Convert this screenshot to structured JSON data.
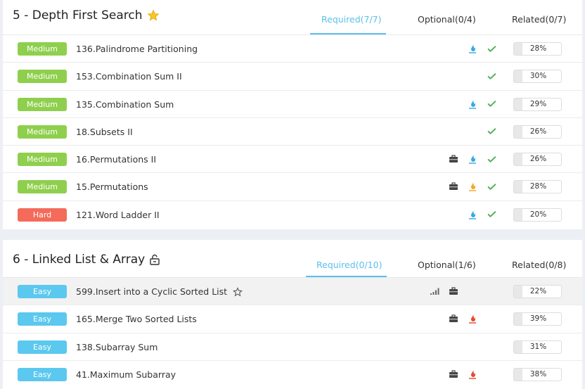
{
  "sections": [
    {
      "title": "5 - Depth First Search",
      "title_icon": "star-filled-icon",
      "tabs": [
        {
          "label": "Required(7/7)",
          "active": true
        },
        {
          "label": "Optional(0/4)",
          "active": false
        },
        {
          "label": "Related(0/7)",
          "active": false
        }
      ],
      "problems": [
        {
          "difficulty": "Medium",
          "name": "136.Palindrome Partitioning",
          "icons": [
            "flame-blue",
            "check"
          ],
          "percent": "28%"
        },
        {
          "difficulty": "Medium",
          "name": "153.Combination Sum II",
          "icons": [
            "check"
          ],
          "percent": "30%"
        },
        {
          "difficulty": "Medium",
          "name": "135.Combination Sum",
          "icons": [
            "flame-blue",
            "check"
          ],
          "percent": "29%"
        },
        {
          "difficulty": "Medium",
          "name": "18.Subsets II",
          "icons": [
            "check"
          ],
          "percent": "26%"
        },
        {
          "difficulty": "Medium",
          "name": "16.Permutations II",
          "icons": [
            "briefcase",
            "flame-blue",
            "check"
          ],
          "percent": "26%"
        },
        {
          "difficulty": "Medium",
          "name": "15.Permutations",
          "icons": [
            "briefcase",
            "flame-orange",
            "check"
          ],
          "percent": "28%"
        },
        {
          "difficulty": "Hard",
          "name": "121.Word Ladder II",
          "icons": [
            "flame-blue",
            "check"
          ],
          "percent": "20%"
        }
      ]
    },
    {
      "title": "6 - Linked List & Array",
      "title_icon": "unlock-icon",
      "tabs": [
        {
          "label": "Required(0/10)",
          "active": true
        },
        {
          "label": "Optional(1/6)",
          "active": false
        },
        {
          "label": "Related(0/8)",
          "active": false
        }
      ],
      "problems": [
        {
          "difficulty": "Easy",
          "name": "599.Insert into a Cyclic Sorted List",
          "icons": [
            "signal",
            "briefcase"
          ],
          "percent": "22%",
          "starred_outline": true
        },
        {
          "difficulty": "Easy",
          "name": "165.Merge Two Sorted Lists",
          "icons": [
            "briefcase",
            "flame-red"
          ],
          "percent": "39%"
        },
        {
          "difficulty": "Easy",
          "name": "138.Subarray Sum",
          "icons": [],
          "percent": "31%"
        },
        {
          "difficulty": "Easy",
          "name": "41.Maximum Subarray",
          "icons": [
            "briefcase",
            "flame-red"
          ],
          "percent": "38%"
        }
      ]
    }
  ],
  "colors": {
    "accent": "#5bc0eb",
    "medium": "#8fcf4e",
    "hard": "#f46b5b",
    "easy": "#5bc8ef",
    "check": "#52b35a",
    "flame_blue": "#36a9e1",
    "flame_orange": "#f5a623",
    "flame_red": "#e8452c"
  }
}
